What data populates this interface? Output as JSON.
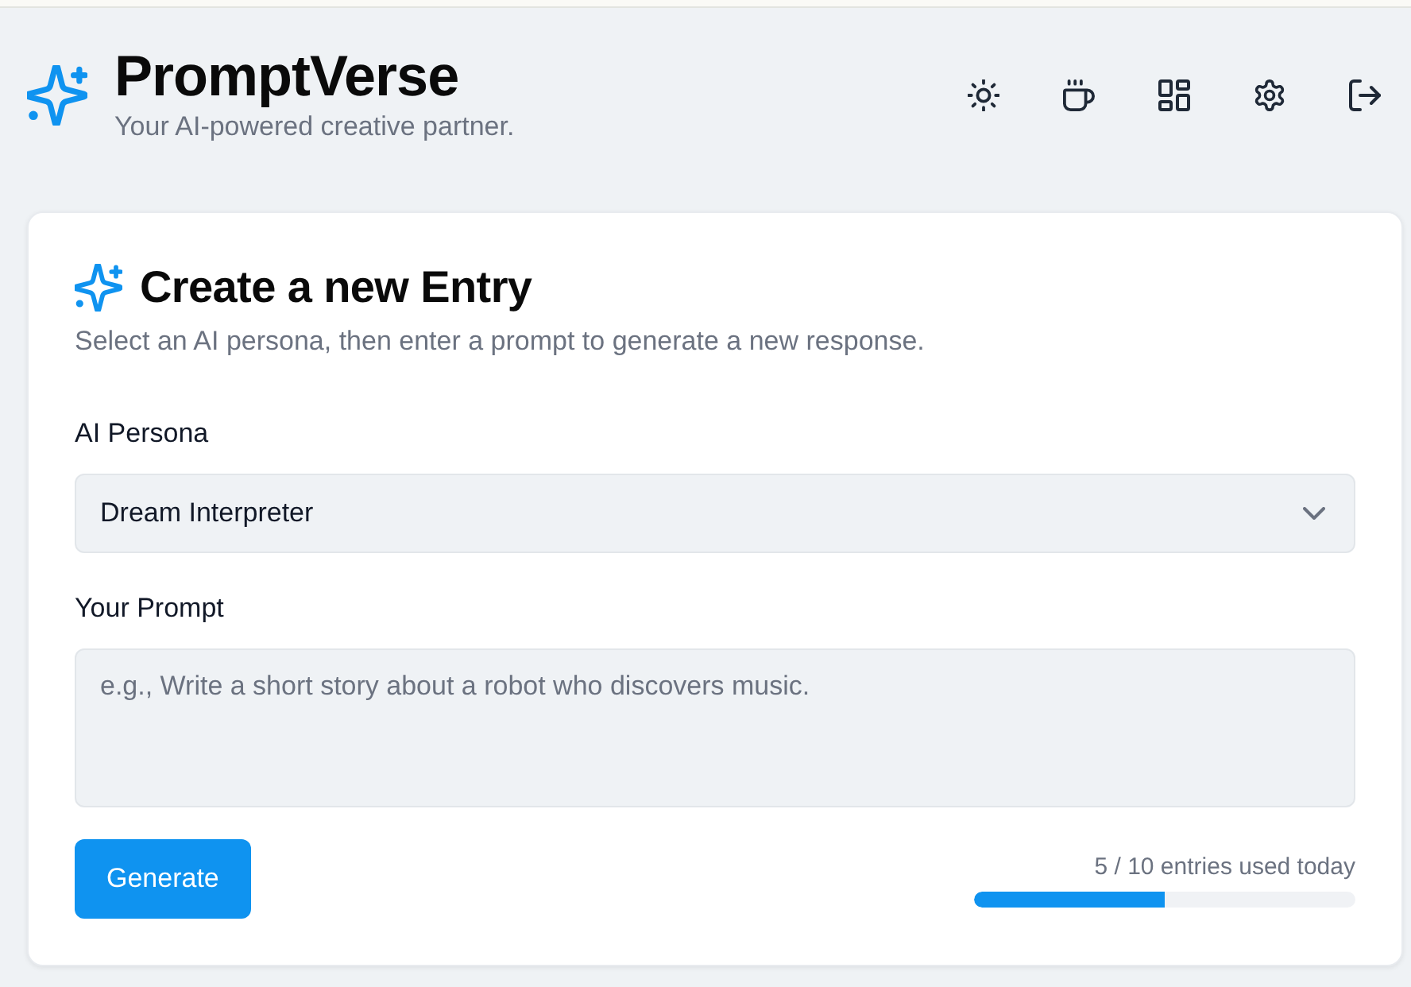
{
  "header": {
    "title": "PromptVerse",
    "subtitle": "Your AI-powered creative partner."
  },
  "card": {
    "title": "Create a new Entry",
    "description": "Select an AI persona, then enter a prompt to generate a new response.",
    "fields": [
      {
        "kind": "select",
        "label": "AI Persona",
        "value": "Dream Interpreter"
      },
      {
        "kind": "textarea",
        "label": "Your Prompt",
        "placeholder": "e.g., Write a short story about a robot who discovers music."
      }
    ],
    "button": "Generate",
    "usage": {
      "text": "5 / 10 entries used today",
      "level": 0.5
    }
  }
}
